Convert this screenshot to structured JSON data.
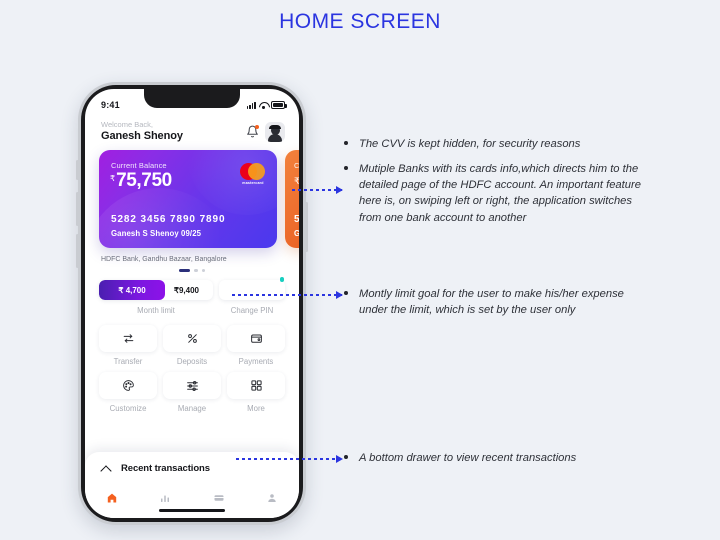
{
  "page": {
    "title": "HOME SCREEN",
    "accent": "#2b35e0",
    "background": "#eef1f6"
  },
  "phone": {
    "status": {
      "time": "9:41",
      "signal_icon": "signal-bars-icon",
      "wifi_icon": "wifi-icon",
      "battery_icon": "battery-icon"
    },
    "header": {
      "welcome": "Welcome Back,",
      "username": "Ganesh Shenoy",
      "bell_icon": "bell-icon",
      "avatar_icon": "avatar-icon"
    },
    "cards": {
      "primary": {
        "label": "Current Balance",
        "currency": "₹",
        "amount": "75,750",
        "number": "5282 3456 7890 7890",
        "owner_and_expiry": "Ganesh S Shenoy  09/25",
        "network": "mastercard",
        "gradient_from": "#a11fe0",
        "gradient_to": "#4a39ee"
      },
      "secondary": {
        "label": "C",
        "currency": "₹",
        "number": "5",
        "owner": "G",
        "color": "#e8591f"
      },
      "bank_line": "HDFC Bank, Gandhu Bazaar, Bangalore",
      "pager": {
        "total": 3,
        "active_index": 0
      }
    },
    "limit": {
      "spent": "₹ 4,700",
      "total": "₹9,400",
      "percent": 58,
      "caption": "Month limit",
      "fill_color": "#8d12e8",
      "pin": {
        "caption": "Change PIN",
        "badge_color": "#17cfc0"
      }
    },
    "actions": [
      {
        "label": "Transfer",
        "icon": "transfer-arrows-icon"
      },
      {
        "label": "Deposits",
        "icon": "percent-icon"
      },
      {
        "label": "Payments",
        "icon": "wallet-icon"
      },
      {
        "label": "Customize",
        "icon": "palette-icon"
      },
      {
        "label": "Manage",
        "icon": "sliders-icon"
      },
      {
        "label": "More",
        "icon": "grid-squares-icon"
      }
    ],
    "drawer": {
      "title": "Recent transactions",
      "chevron_icon": "chevron-up-icon"
    },
    "navbar": [
      {
        "icon": "home-icon",
        "active": true,
        "color": "#f4601f"
      },
      {
        "icon": "chart-icon",
        "active": false,
        "color": "#b9bcc4"
      },
      {
        "icon": "card-icon",
        "active": false,
        "color": "#b9bcc4"
      },
      {
        "icon": "profile-icon",
        "active": false,
        "color": "#b9bcc4"
      }
    ]
  },
  "annotations": [
    {
      "text": "The CVV is kept hidden, for security reasons"
    },
    {
      "text": "Mutiple Banks with its cards info,which directs him to the detailed page of the HDFC account. An important feature here is, on swiping left or right, the application switches from one bank account to another"
    },
    {
      "text": "Montly limit goal for the user to make his/her expense under the limit, which is set by the user only"
    },
    {
      "text": "A bottom drawer to view recent transactions"
    }
  ]
}
